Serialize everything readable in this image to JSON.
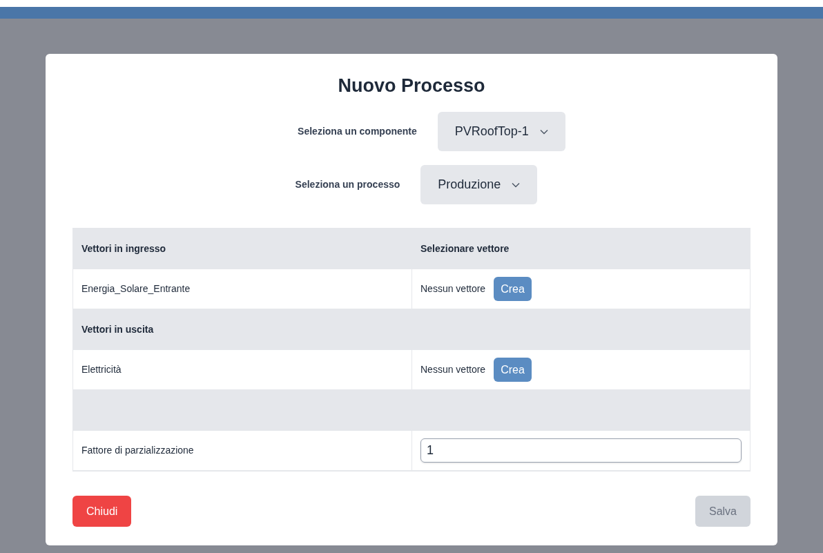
{
  "modal": {
    "title": "Nuovo Processo",
    "selects": [
      {
        "label": "Seleziona un componente",
        "value": "PVRoofTop-1"
      },
      {
        "label": "Seleziona un processo",
        "value": "Produzione"
      }
    ],
    "table": {
      "rows": [
        {
          "kind": "header",
          "cells": [
            "Vettori in ingresso",
            "Selezionare vettore"
          ]
        },
        {
          "kind": "vector",
          "name": "Energia_Solare_Entrante",
          "status": "Nessun vettore",
          "action": "Crea"
        },
        {
          "kind": "section",
          "cells": [
            "Vettori in uscita"
          ]
        },
        {
          "kind": "vector",
          "name": "Elettricità",
          "status": "Nessun vettore",
          "action": "Crea"
        },
        {
          "kind": "blank"
        },
        {
          "kind": "input",
          "name": "Fattore di parzializzazione",
          "value": "1"
        }
      ]
    },
    "buttons": [
      {
        "label": "Chiudi",
        "kind": "danger",
        "disabled": false
      },
      {
        "label": "Salva",
        "kind": "primary",
        "disabled": true
      }
    ]
  }
}
